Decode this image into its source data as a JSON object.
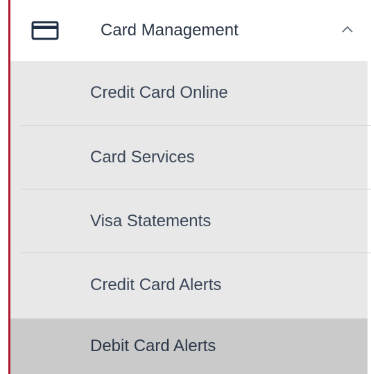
{
  "nav": {
    "parent": {
      "label": "Card Management",
      "icon": "card-icon",
      "expanded": true,
      "chevron_icon": "chevron-up-icon"
    },
    "submenu": [
      {
        "label": "Credit Card Online",
        "active": false
      },
      {
        "label": "Card Services",
        "active": false
      },
      {
        "label": "Visa Statements",
        "active": false
      },
      {
        "label": "Credit Card Alerts",
        "active": false
      },
      {
        "label": "Debit Card Alerts",
        "active": true
      }
    ]
  },
  "colors": {
    "accent": "#b0182f",
    "submenu_background": "#e8e8e8",
    "active_background": "#cacaca",
    "text": "#2a3545"
  }
}
